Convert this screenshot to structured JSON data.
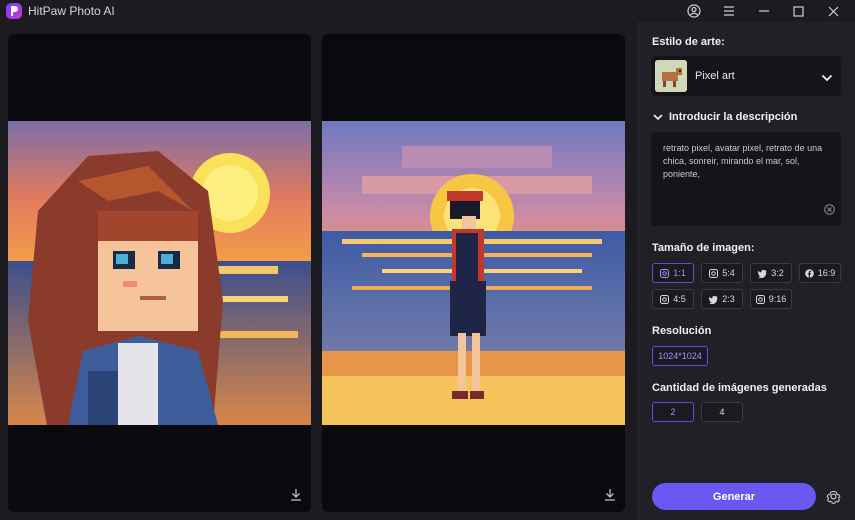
{
  "app": {
    "title": "HitPaw Photo AI"
  },
  "panel": {
    "art_style_label": "Estilo de arte:",
    "selected_style": "Pixel art",
    "description_toggle": "Introducir la descripción",
    "description_text": "retrato pixel, avatar pixel, retrato de una chica, sonreir, mirando el mar, sol, poniente,",
    "image_size_label": "Tamaño de imagen:",
    "sizes": [
      {
        "label": "1:1",
        "icon": "instagram-icon",
        "selected": true
      },
      {
        "label": "5:4",
        "icon": "instagram-icon",
        "selected": false
      },
      {
        "label": "3:2",
        "icon": "twitter-icon",
        "selected": false
      },
      {
        "label": "16:9",
        "icon": "facebook-icon",
        "selected": false
      },
      {
        "label": "4:5",
        "icon": "instagram-icon",
        "selected": false
      },
      {
        "label": "2:3",
        "icon": "twitter-icon",
        "selected": false
      },
      {
        "label": "9:16",
        "icon": "instagram-icon",
        "selected": false
      }
    ],
    "resolution_label": "Resolución",
    "resolution_value": "1024*1024",
    "count_label": "Cantidad de imágenes generadas",
    "counts": [
      {
        "label": "2",
        "selected": true
      },
      {
        "label": "4",
        "selected": false
      }
    ],
    "generate_label": "Generar"
  },
  "colors": {
    "accent": "#6b57f2",
    "panel_bg": "#202026",
    "canvas_bg": "#0a090e"
  }
}
